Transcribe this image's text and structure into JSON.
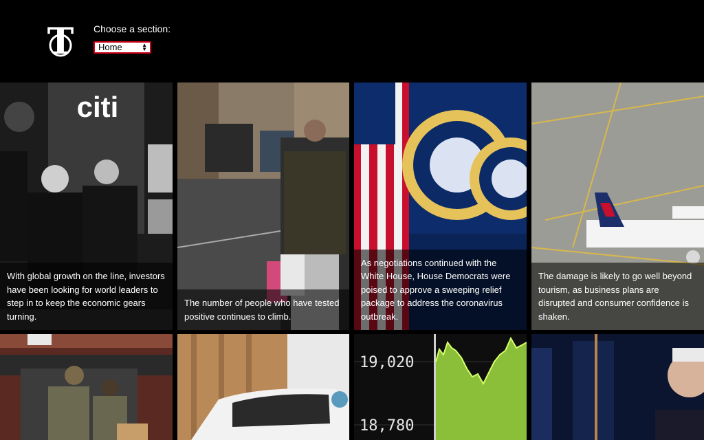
{
  "header": {
    "logo_icon": "nyt-t-logo-icon",
    "section_label": "Choose a section:",
    "section_selected": "Home",
    "select_arrows_icon": "updown-arrows-icon",
    "accent_color": "#d0021b"
  },
  "stories": [
    {
      "caption": "With global growth on the line, investors have been looking for world leaders to step in to keep the economic gears turning.",
      "image_text": "citi"
    },
    {
      "caption": "The number of people who have tested positive continues to climb."
    },
    {
      "caption": "As negotiations continued with the White House, House Democrats were poised to approve a sweeping relief package to address the coronavirus outbreak."
    },
    {
      "caption": "The damage is likely to go well beyond tourism, as business plans are disrupted and consumer confidence is shaken."
    },
    {
      "caption": ""
    },
    {
      "caption": ""
    },
    {
      "caption": "",
      "ticker_values": [
        "19,020",
        "18,780"
      ]
    },
    {
      "caption": ""
    }
  ]
}
